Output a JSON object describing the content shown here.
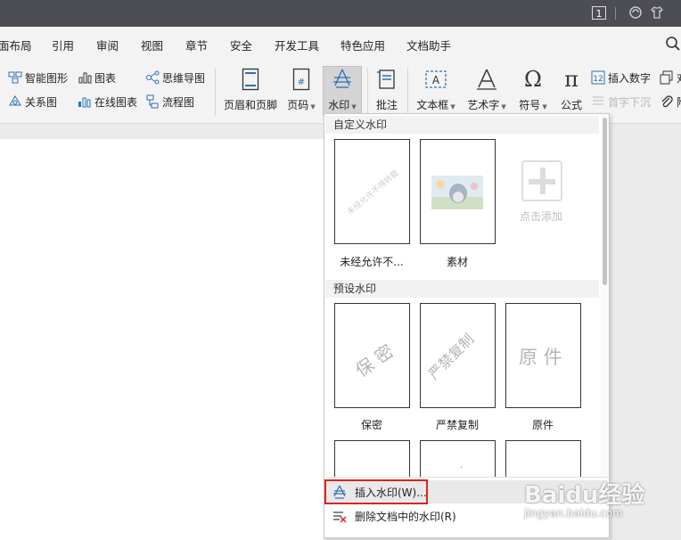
{
  "titlebar": {
    "badge": "1"
  },
  "menubar": {
    "items": [
      "面布局",
      "引用",
      "审阅",
      "视图",
      "章节",
      "安全",
      "开发工具",
      "特色应用",
      "文档助手"
    ]
  },
  "ribbon": {
    "smart_graphic": "智能图形",
    "chart": "图表",
    "mind_map": "思维导图",
    "relation_graph": "关系图",
    "online_chart": "在线图表",
    "flowchart": "流程图",
    "header_footer": "页眉和页脚",
    "page_number": "页码",
    "watermark": "水印",
    "comment": "批注",
    "textbox": "文本框",
    "wordart": "艺术字",
    "symbol": "符号",
    "formula": "公式",
    "insert_number": "插入数字",
    "drop_cap": "首字下沉",
    "right_cut_1": "对",
    "right_cut_2": "附"
  },
  "dropdown": {
    "custom_title": "自定义水印",
    "custom_items": [
      {
        "label": "未经允许不...",
        "preview_text": "未经允许不得转载"
      },
      {
        "label": "素材"
      }
    ],
    "add_label": "点击添加",
    "preset_title": "预设水印",
    "preset_items": [
      {
        "label": "保密",
        "preview_text": "保 密"
      },
      {
        "label": "严禁复制",
        "preview_text": "严禁复制"
      },
      {
        "label": "原件",
        "preview_text": "原 件"
      }
    ],
    "insert_watermark": "插入水印(W)...",
    "remove_watermark": "删除文档中的水印(R)"
  },
  "overlay": {
    "brand": "Baidu经验",
    "url": "jingyan.baidu.com"
  },
  "colors": {
    "titlebar": "#4d4d55",
    "ribbon_bg": "#f3f3f3",
    "highlight_red": "#d9251c",
    "icon_blue": "#2c6fb5"
  }
}
